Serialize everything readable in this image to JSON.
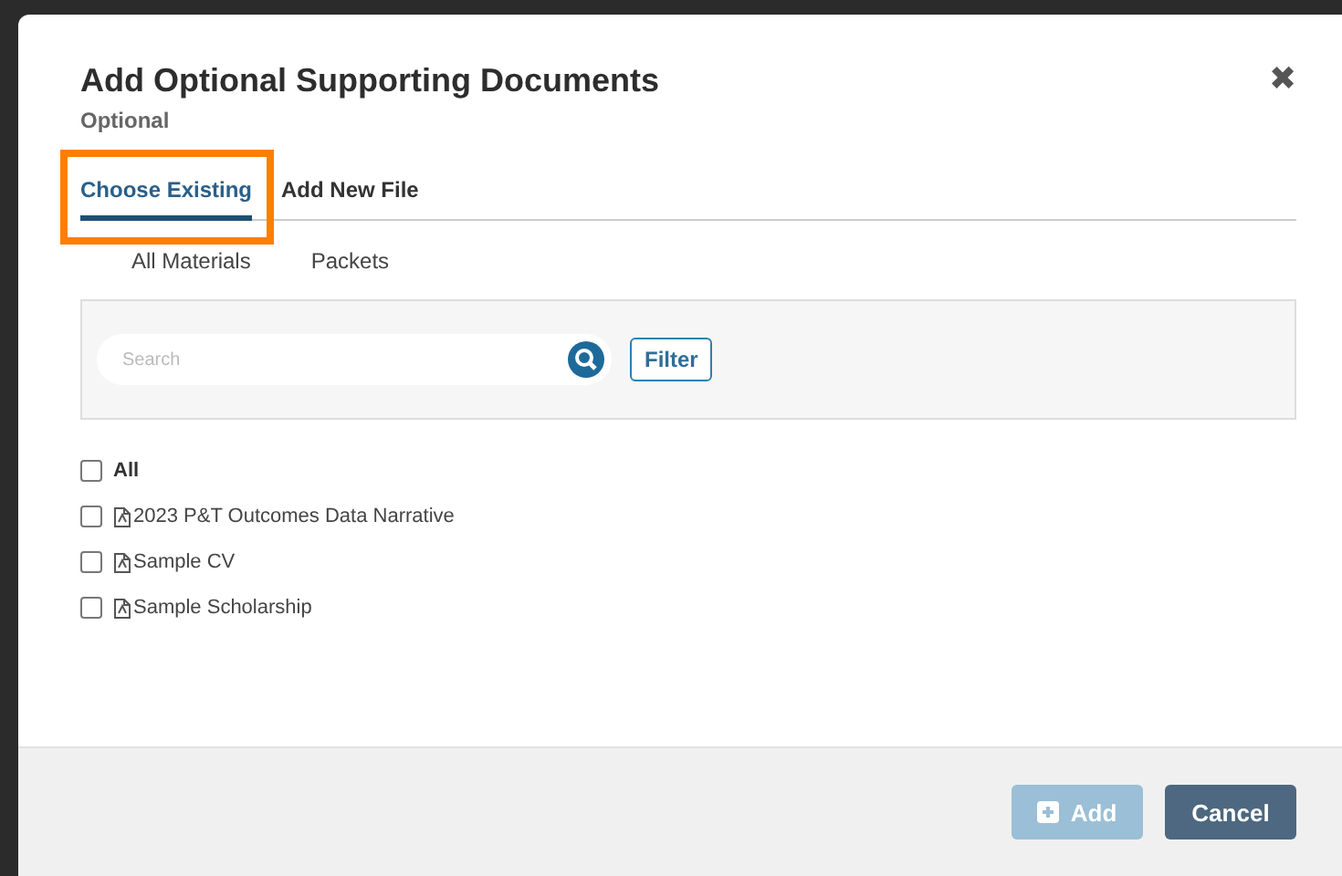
{
  "dialog": {
    "title": "Add Optional Supporting Documents",
    "subtitle": "Optional",
    "close": "✖"
  },
  "tabs": [
    {
      "label": "Choose Existing",
      "selected": true,
      "highlighted": true
    },
    {
      "label": "Add New File",
      "selected": false,
      "highlighted": false
    }
  ],
  "subtabs": [
    {
      "label": "All Materials"
    },
    {
      "label": "Packets"
    }
  ],
  "search": {
    "placeholder": "Search"
  },
  "filter_button": "Filter",
  "select_all": {
    "label": "All",
    "checked": false
  },
  "documents": [
    {
      "name": "2023 P&T Outcomes Data Narrative",
      "checked": false
    },
    {
      "name": "Sample CV",
      "checked": false
    },
    {
      "name": "Sample Scholarship",
      "checked": false
    }
  ],
  "buttons": [
    {
      "label": "Add",
      "kind": "primary",
      "disabled": true
    },
    {
      "label": "Cancel",
      "kind": "secondary",
      "disabled": false
    }
  ]
}
